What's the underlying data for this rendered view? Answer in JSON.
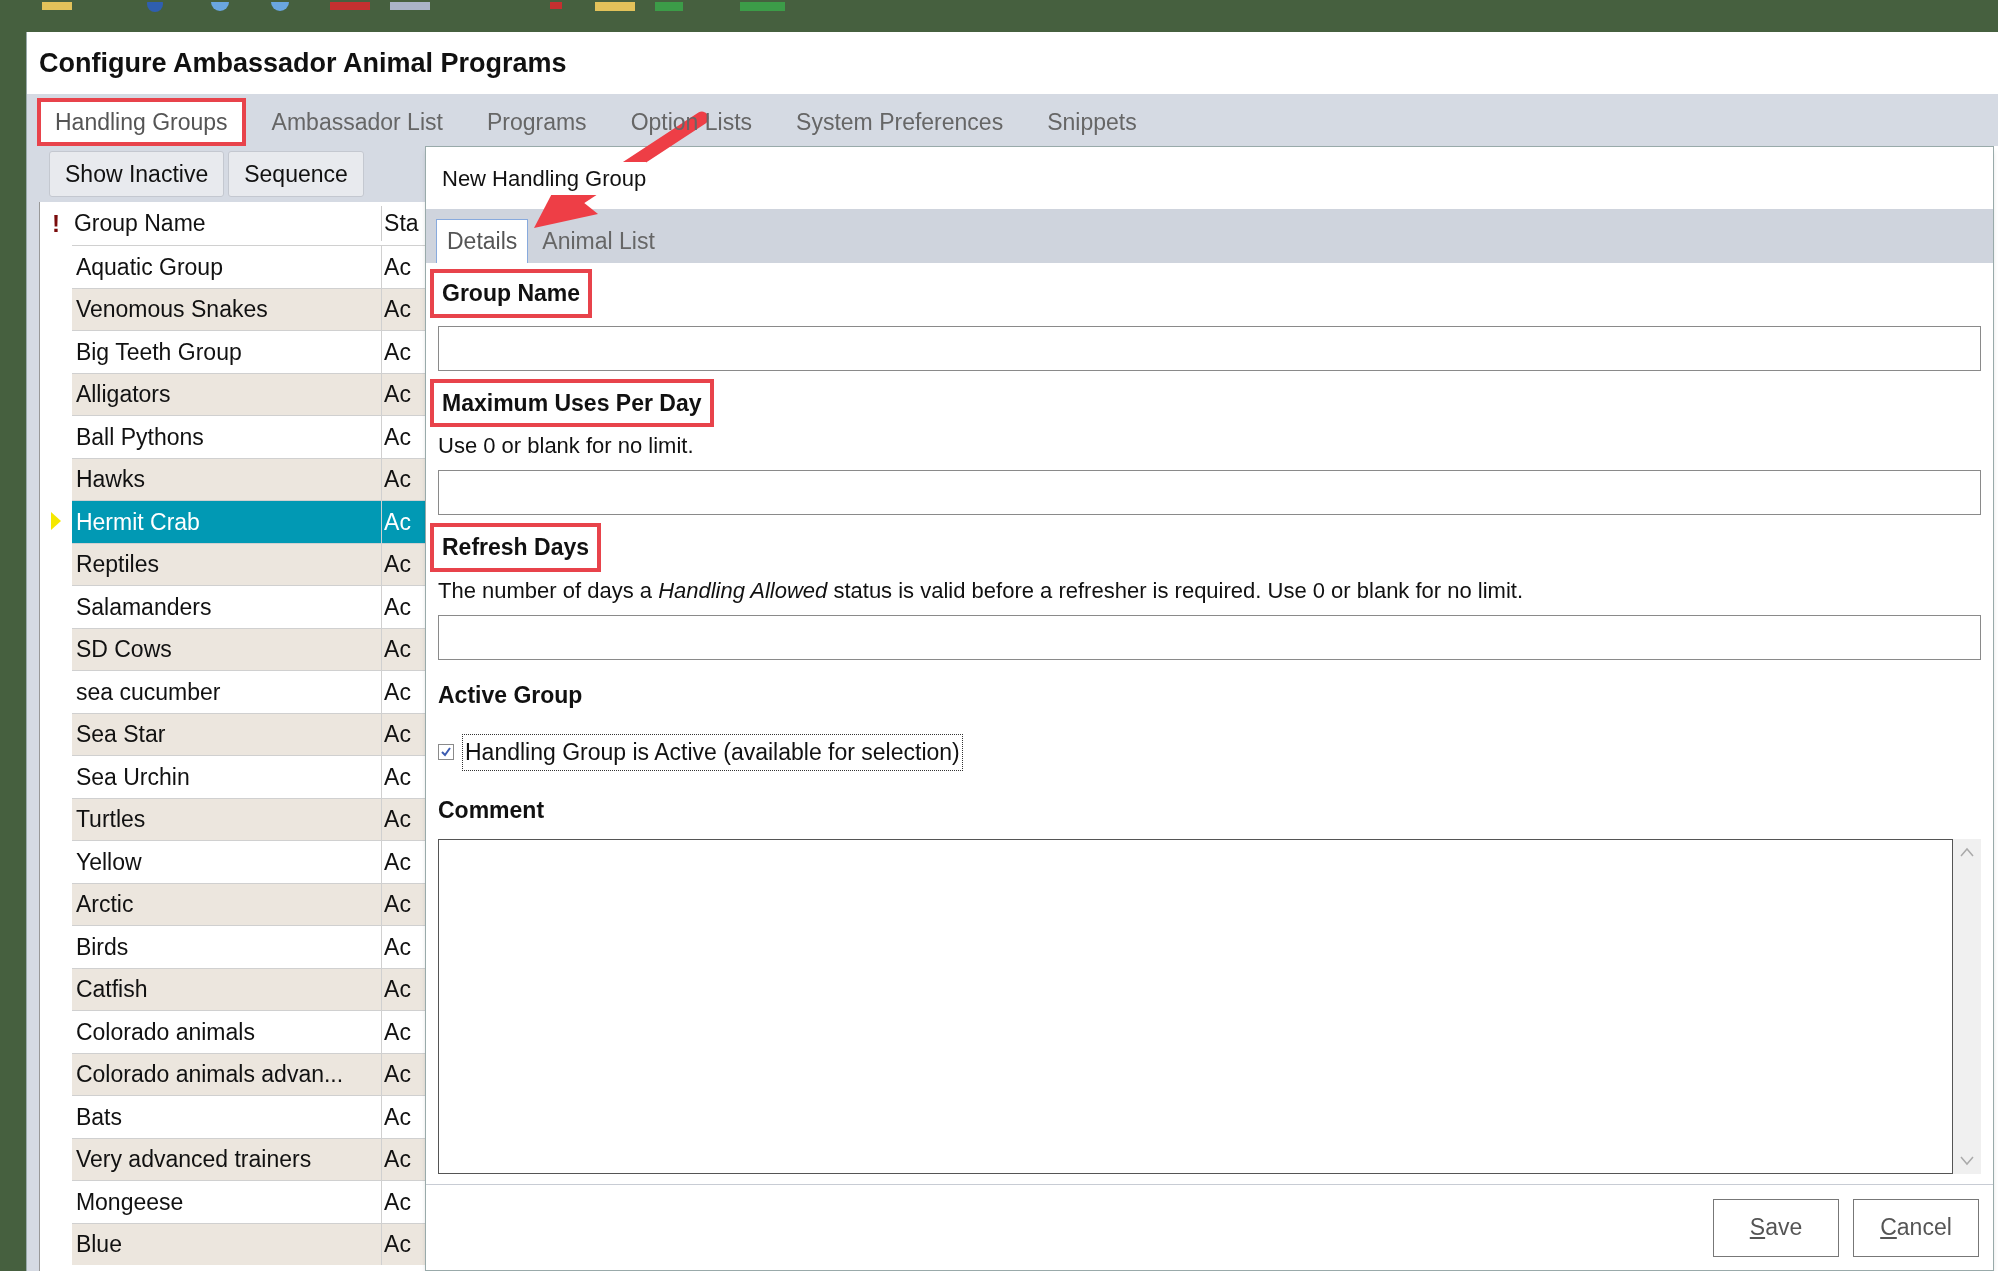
{
  "window": {
    "title": "Configure Ambassador Animal Programs"
  },
  "tabs": [
    {
      "label": "Handling Groups",
      "selected": true,
      "highlighted": true
    },
    {
      "label": "Ambassador List",
      "selected": false,
      "highlighted": false
    },
    {
      "label": "Programs",
      "selected": false,
      "highlighted": false
    },
    {
      "label": "Option Lists",
      "selected": false,
      "highlighted": false
    },
    {
      "label": "System Preferences",
      "selected": false,
      "highlighted": false
    },
    {
      "label": "Snippets",
      "selected": false,
      "highlighted": false
    }
  ],
  "list_buttons": [
    "Show Inactive",
    "Sequence"
  ],
  "grid": {
    "flag_header": "!",
    "columns": [
      "Group Name",
      "Sta"
    ],
    "rows": [
      {
        "name": "Aquatic Group",
        "status": "Ac",
        "selected": false
      },
      {
        "name": "Venomous Snakes",
        "status": "Ac",
        "selected": false
      },
      {
        "name": "Big Teeth Group",
        "status": "Ac",
        "selected": false
      },
      {
        "name": "Alligators",
        "status": "Ac",
        "selected": false
      },
      {
        "name": "Ball Pythons",
        "status": "Ac",
        "selected": false
      },
      {
        "name": "Hawks",
        "status": "Ac",
        "selected": false
      },
      {
        "name": "Hermit Crab",
        "status": "Ac",
        "selected": true
      },
      {
        "name": "Reptiles",
        "status": "Ac",
        "selected": false
      },
      {
        "name": "Salamanders",
        "status": "Ac",
        "selected": false
      },
      {
        "name": "SD Cows",
        "status": "Ac",
        "selected": false
      },
      {
        "name": "sea cucumber",
        "status": "Ac",
        "selected": false
      },
      {
        "name": "Sea Star",
        "status": "Ac",
        "selected": false
      },
      {
        "name": "Sea Urchin",
        "status": "Ac",
        "selected": false
      },
      {
        "name": "Turtles",
        "status": "Ac",
        "selected": false
      },
      {
        "name": "Yellow",
        "status": "Ac",
        "selected": false
      },
      {
        "name": "Arctic",
        "status": "Ac",
        "selected": false
      },
      {
        "name": "Birds",
        "status": "Ac",
        "selected": false
      },
      {
        "name": "Catfish",
        "status": "Ac",
        "selected": false
      },
      {
        "name": "Colorado animals",
        "status": "Ac",
        "selected": false
      },
      {
        "name": "Colorado animals advan...",
        "status": "Ac",
        "selected": false
      },
      {
        "name": "Bats",
        "status": "Ac",
        "selected": false
      },
      {
        "name": "Very advanced trainers",
        "status": "Ac",
        "selected": false
      },
      {
        "name": "Mongeese",
        "status": "Ac",
        "selected": false
      },
      {
        "name": "Blue",
        "status": "Ac",
        "selected": false
      }
    ]
  },
  "dialog": {
    "title": "New Handling Group",
    "tabs": [
      {
        "label": "Details",
        "selected": true
      },
      {
        "label": "Animal List",
        "selected": false
      }
    ],
    "fields": [
      {
        "label": "Group Name",
        "highlighted": true
      },
      {
        "label": "Maximum Uses Per Day",
        "highlighted": true,
        "hint": "Use 0 or blank for no limit."
      },
      {
        "label": "Refresh Days",
        "highlighted": true,
        "hint": "The number of days a *Handling Allowed* status is valid before a refresher is required. Use 0 or blank for no limit."
      }
    ],
    "active": {
      "label": "Active Group",
      "checkbox": {
        "label": "Handling Group is Active (available for selection)",
        "checked": true
      }
    },
    "comment": {
      "label": "Comment"
    },
    "buttons": [
      {
        "mnemonic": "S",
        "rest": "ave"
      },
      {
        "mnemonic": "C",
        "rest": "ancel"
      }
    ]
  }
}
